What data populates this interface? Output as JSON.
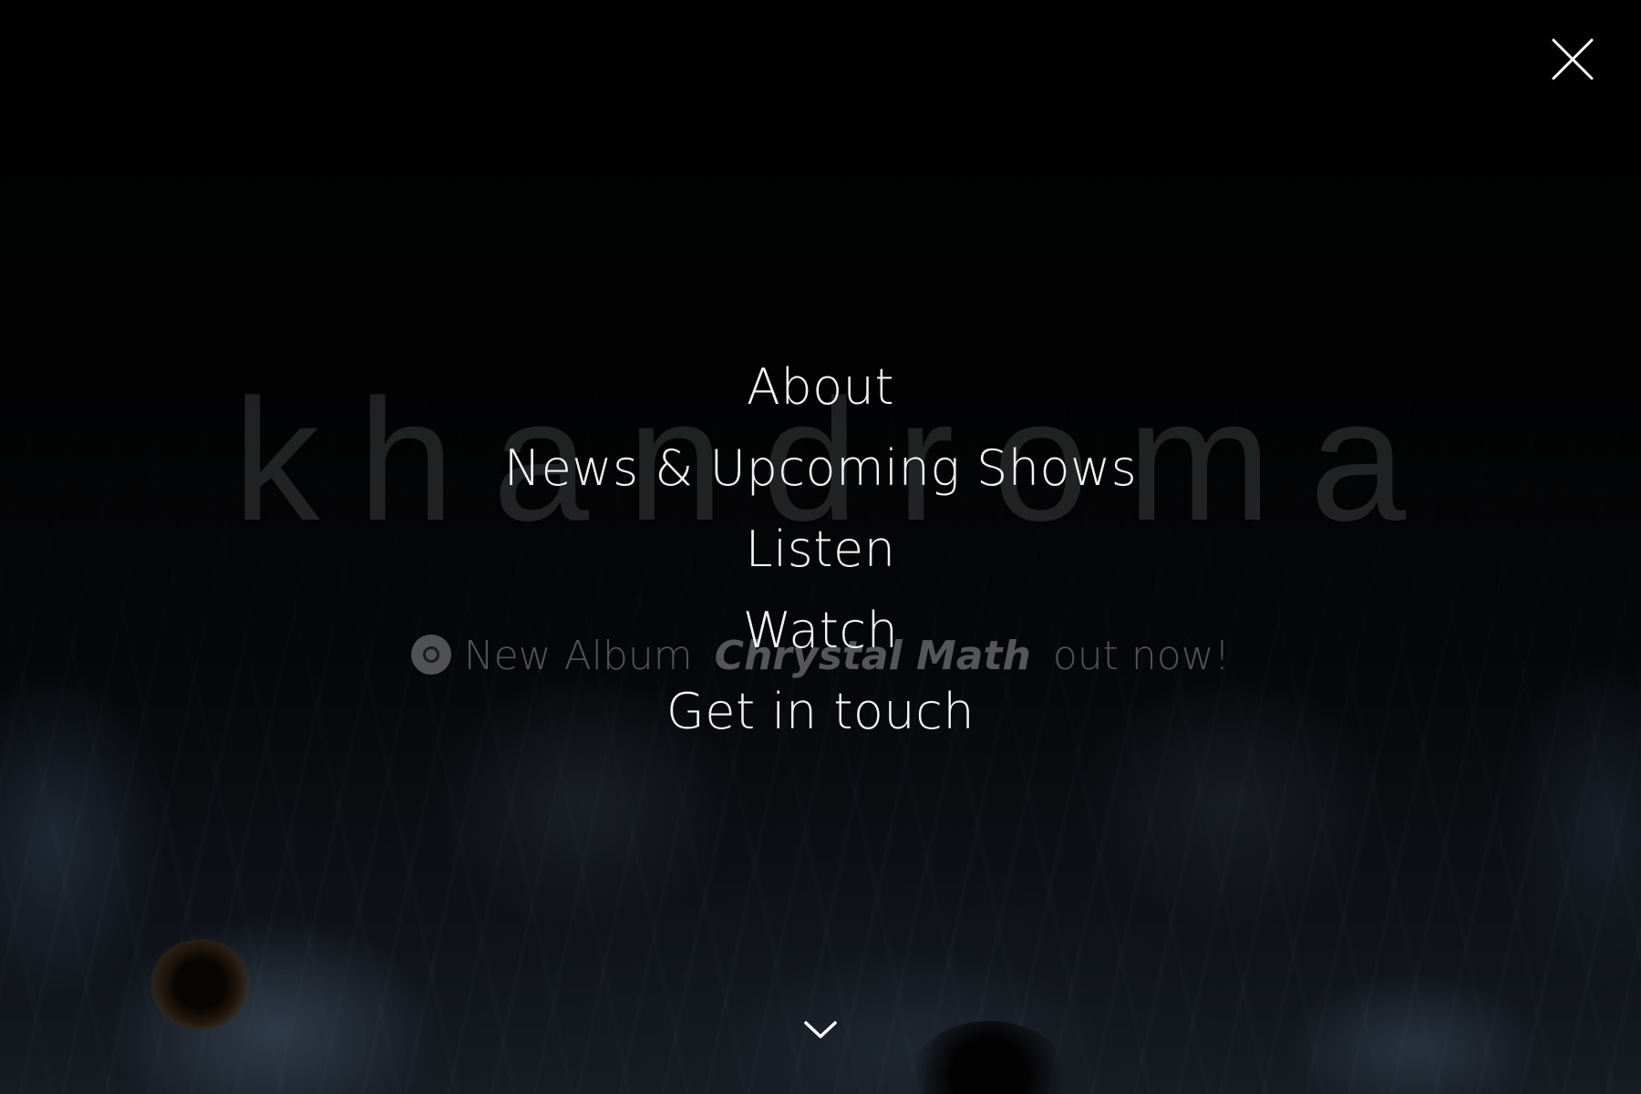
{
  "brand": {
    "wordmark": "khandroma"
  },
  "announcement": {
    "prefix": "New Album",
    "album_title": "Chrystal Math",
    "suffix": "out now!",
    "icon": "disc-icon"
  },
  "menu": {
    "items": [
      {
        "label": "About"
      },
      {
        "label": "News & Upcoming Shows"
      },
      {
        "label": "Listen"
      },
      {
        "label": "Watch"
      },
      {
        "label": "Get in touch"
      }
    ]
  },
  "controls": {
    "close_icon": "close-icon",
    "scroll_icon": "chevron-down-icon"
  },
  "colors": {
    "menu_text": "#f4f4f4",
    "background": "#020203"
  }
}
